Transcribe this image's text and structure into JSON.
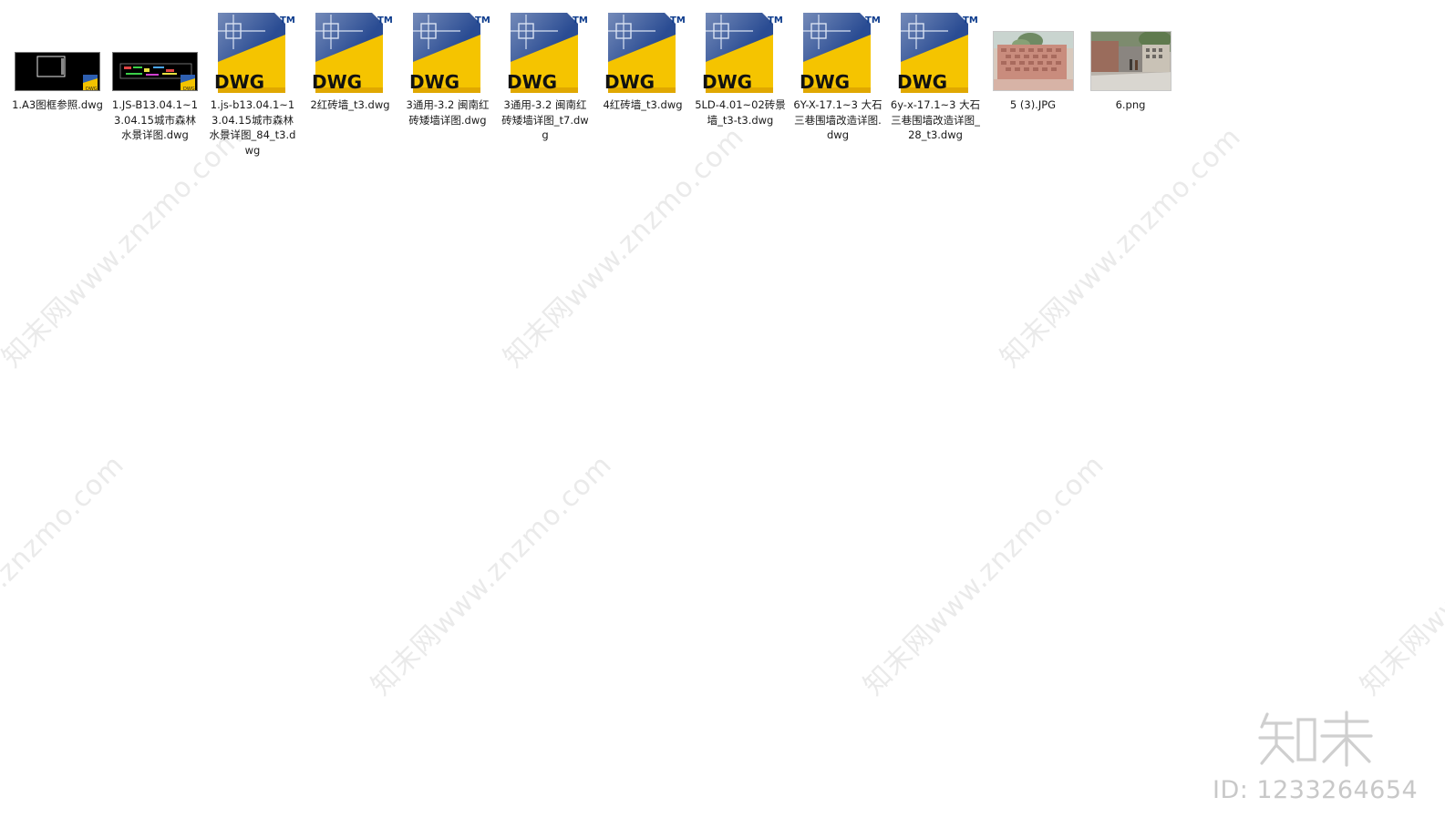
{
  "files": [
    {
      "name": "1.A3图框参照.dwg",
      "type": "dwg-drawing-thumbnail",
      "badge": "DWG"
    },
    {
      "name": "1.JS-B13.04.1~13.04.15城市森林水景详图.dwg",
      "type": "dwg-drawing-thumbnail",
      "badge": "DWG"
    },
    {
      "name": "1.js-b13.04.1~13.04.15城市森林水景详图_84_t3.dwg",
      "type": "dwg-icon",
      "badge": "DWG"
    },
    {
      "name": "2红砖墙_t3.dwg",
      "type": "dwg-icon",
      "badge": "DWG"
    },
    {
      "name": "3通用-3.2 闽南红砖矮墙详图.dwg",
      "type": "dwg-icon",
      "badge": "DWG"
    },
    {
      "name": "3通用-3.2 闽南红砖矮墙详图_t7.dwg",
      "type": "dwg-icon",
      "badge": "DWG"
    },
    {
      "name": "4红砖墙_t3.dwg",
      "type": "dwg-icon",
      "badge": "DWG"
    },
    {
      "name": "5LD-4.01~02砖景墙_t3-t3.dwg",
      "type": "dwg-icon",
      "badge": "DWG"
    },
    {
      "name": "6Y-X-17.1~3 大石三巷围墙改造详图.dwg",
      "type": "dwg-icon",
      "badge": "DWG"
    },
    {
      "name": "6y-x-17.1~3 大石三巷围墙改造详图_28_t3.dwg",
      "type": "dwg-icon",
      "badge": "DWG"
    },
    {
      "name": "5 (3).JPG",
      "type": "photo-brick-wall"
    },
    {
      "name": "6.png",
      "type": "photo-street"
    }
  ],
  "icon": {
    "badge": "DWG",
    "tm": "TM"
  },
  "watermark": {
    "text": "知末网www.znzmo.com"
  },
  "brand": {
    "logo": "知末",
    "id_text": "ID: 1233264654"
  },
  "colors": {
    "dwg_yellow": "#f5c400",
    "dwg_blue": "#1f3f8a",
    "tm_blue": "#0b3a8c",
    "text": "#1a1a1a",
    "watermark": "#c8c8c8"
  }
}
